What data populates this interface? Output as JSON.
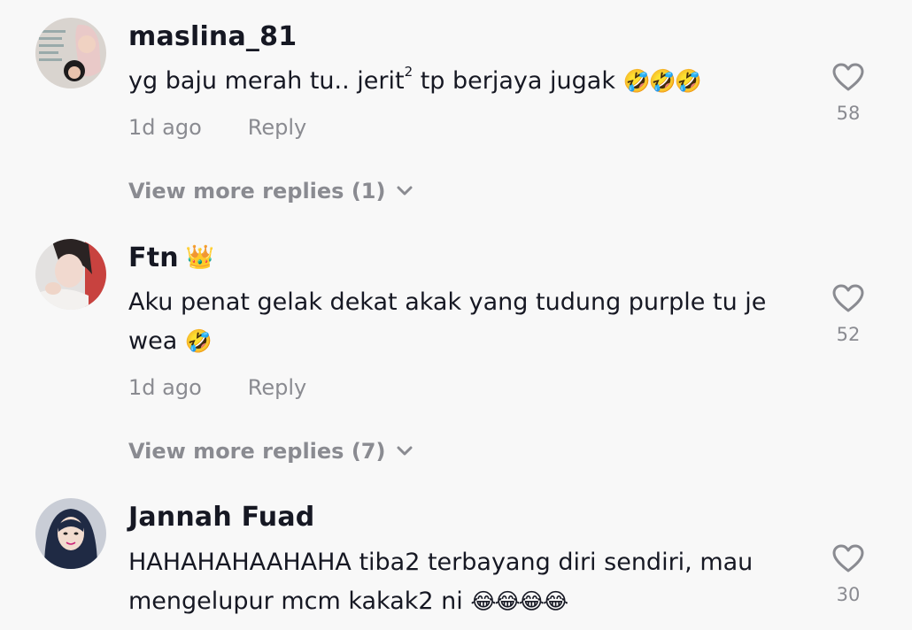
{
  "comments": [
    {
      "username": "maslina_81",
      "text": "yg baju merah tu.. jerit",
      "text_sup": "2",
      "text_after": " tp berjaya jugak ",
      "emojis": "🤣🤣🤣",
      "time": "1d ago",
      "reply_label": "Reply",
      "likes": "58",
      "more_replies": "View more replies (1)"
    },
    {
      "username": "Ftn",
      "badge": "👑",
      "text": "Aku penat gelak dekat akak yang tudung purple tu je wea ",
      "emojis": "🤣",
      "time": "1d ago",
      "reply_label": "Reply",
      "likes": "52",
      "more_replies": "View more replies (7)"
    },
    {
      "username": "Jannah Fuad",
      "text": "HAHAHAHAAHAHA tiba2 terbayang diri sendiri, mau mengelupur mcm kakak2 ni ",
      "emojis": "😂😂😂😂",
      "likes": "30"
    }
  ],
  "colors": {
    "background": "#f8f8f8",
    "primary_text": "#161823",
    "secondary_text": "#8a8b91"
  }
}
